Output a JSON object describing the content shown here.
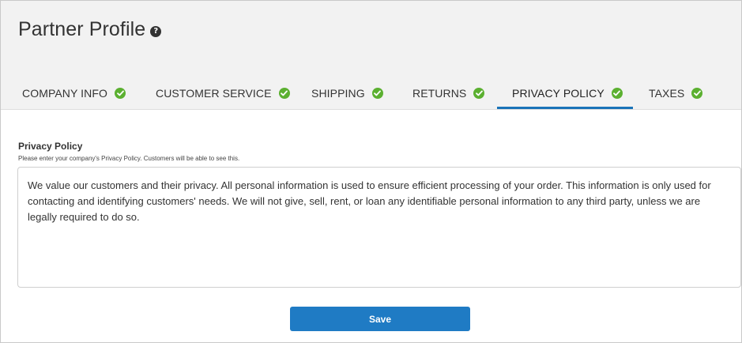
{
  "header": {
    "title": "Partner Profile",
    "help_icon": "question-circle-icon"
  },
  "tabs": [
    {
      "label": "COMPANY INFO",
      "status": "complete",
      "icon": "check-circle-icon",
      "active": false
    },
    {
      "label": "CUSTOMER SERVICE",
      "status": "complete",
      "icon": "check-circle-icon",
      "active": false
    },
    {
      "label": "SHIPPING",
      "status": "complete",
      "icon": "check-circle-icon",
      "active": false
    },
    {
      "label": "RETURNS",
      "status": "complete",
      "icon": "check-circle-icon",
      "active": false
    },
    {
      "label": "PRIVACY POLICY",
      "status": "complete",
      "icon": "check-circle-icon",
      "active": true
    },
    {
      "label": "TAXES",
      "status": "complete",
      "icon": "check-circle-icon",
      "active": false
    }
  ],
  "privacy_policy": {
    "label": "Privacy Policy",
    "hint": "Please enter your company's Privacy Policy. Customers will be able to see this.",
    "value": "We value our customers and their privacy. All personal information is used to ensure efficient processing of your order. This information is only used for contacting and identifying customers' needs. We will not give, sell, rent, or loan any identifiable personal information to any third party, unless we are legally required to do so."
  },
  "actions": {
    "save_label": "Save"
  },
  "colors": {
    "accent": "#1f7bc4",
    "active_tab_underline": "#1a73b8",
    "check_green": "#5bb030",
    "header_bg": "#f2f2f2"
  }
}
